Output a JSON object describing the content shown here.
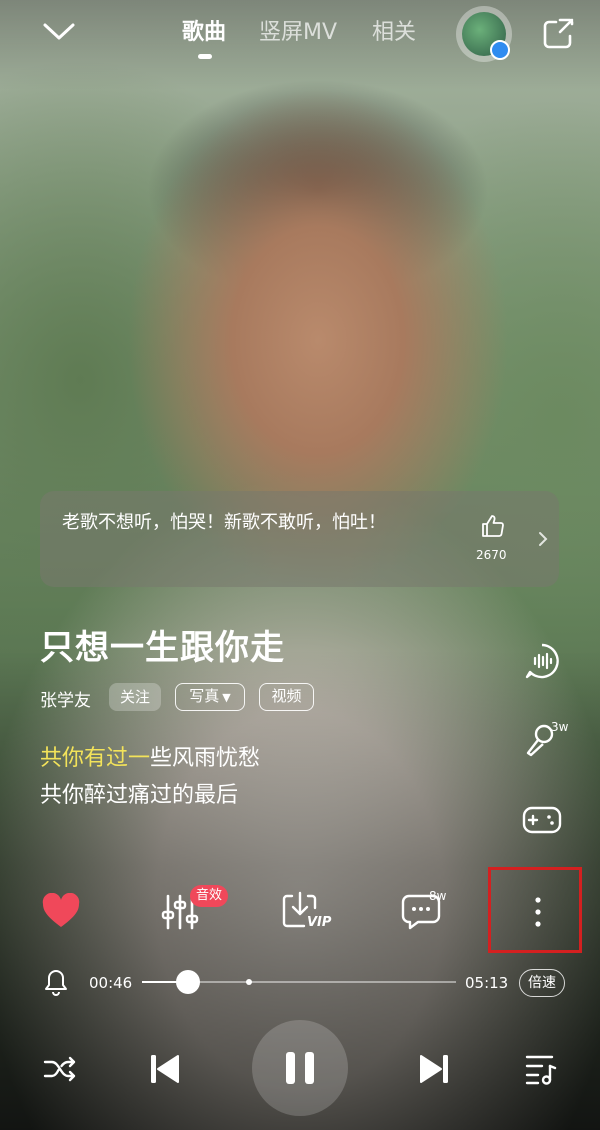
{
  "tabs": [
    {
      "label": "歌曲",
      "active": true
    },
    {
      "label": "竖屏MV",
      "active": false
    },
    {
      "label": "相关",
      "active": false
    }
  ],
  "icons": {
    "collapse": "chevron-down-icon",
    "share": "share-icon",
    "avatar": "listening-avatar",
    "comment_like": "thumbs-up-icon",
    "comment_next": "chevron-right-icon",
    "voice": "voice-wave-icon",
    "karaoke": "microphone-icon",
    "game": "gamepad-icon",
    "favorite": "heart-icon",
    "effects": "equalizer-icon",
    "download": "download-vip-icon",
    "comments": "comment-bubble-icon",
    "more": "more-vertical-icon",
    "alarm": "bell-icon",
    "shuffle": "shuffle-icon",
    "prev": "previous-icon",
    "pause": "pause-icon",
    "next": "next-icon",
    "playlist": "playlist-icon"
  },
  "comment": {
    "text": "老歌不想听，怕哭！新歌不敢听，怕吐！",
    "likes": "2670"
  },
  "song": {
    "title": "只想一生跟你走",
    "artist": "张学友",
    "follow": "关注",
    "photos": "写真",
    "video": "视频"
  },
  "lyrics": {
    "current_sung": "共你有过一",
    "current_rest": "些风雨忧愁",
    "next": "共你醉过痛过的最后"
  },
  "actions": {
    "effects_badge": "音效",
    "karaoke_count": "3w",
    "comments_count": "8w",
    "vip": "VIP"
  },
  "player": {
    "elapsed": "00:46",
    "duration": "05:13",
    "progress": 0.147,
    "speed_label": "倍速"
  },
  "colors": {
    "lyric_highlight": "#f3e35a",
    "heart": "#f0485a",
    "badge": "#f0485a",
    "annotation_box": "#d42020"
  }
}
